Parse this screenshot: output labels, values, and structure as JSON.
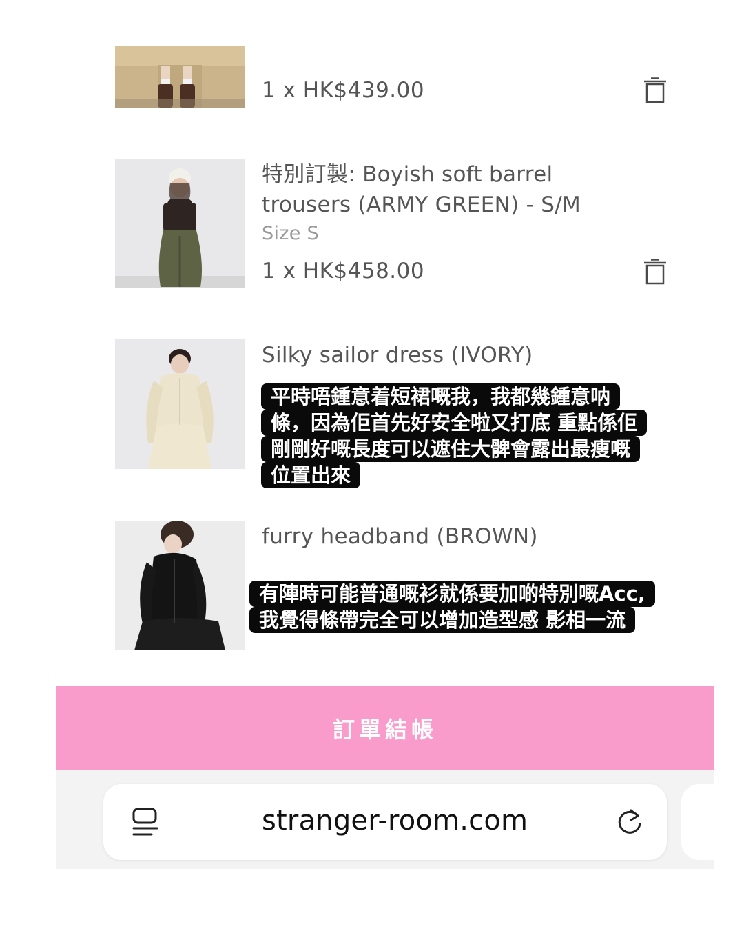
{
  "cart": {
    "items": [
      {
        "name": "",
        "size": "",
        "quantity_price": "1 x  HK$439.00"
      },
      {
        "name_line1": "特別訂製: Boyish soft barrel",
        "name_line2": "trousers (ARMY GREEN) - S/M",
        "size": "Size S",
        "quantity_price": "1 x  HK$458.00"
      },
      {
        "name": "Silky sailor dress (IVORY)"
      },
      {
        "name": "furry headband (BROWN)"
      }
    ]
  },
  "captions": {
    "dress": [
      "平時唔鍾意着短裙嘅我，我都幾鍾意呐",
      "條，因為佢首先好安全啦又打底 重點係佢",
      "剛剛好嘅長度可以遮住大髀會露出最瘦嘅",
      "位置出來"
    ],
    "headband": [
      "有陣時可能普通嘅衫就係要加啲特別嘅Acc,",
      "我覺得條帶完全可以增加造型感 影相一流"
    ]
  },
  "checkout": {
    "label": "訂單結帳"
  },
  "browser": {
    "url": "stranger-room.com"
  },
  "icons": {
    "trash": "trash-icon",
    "reader": "reader-mode-icon",
    "reload": "reload-icon"
  },
  "colors": {
    "checkout_bg": "#f99bcb",
    "caption_bg": "#0a0a0a",
    "text": "#555555"
  }
}
